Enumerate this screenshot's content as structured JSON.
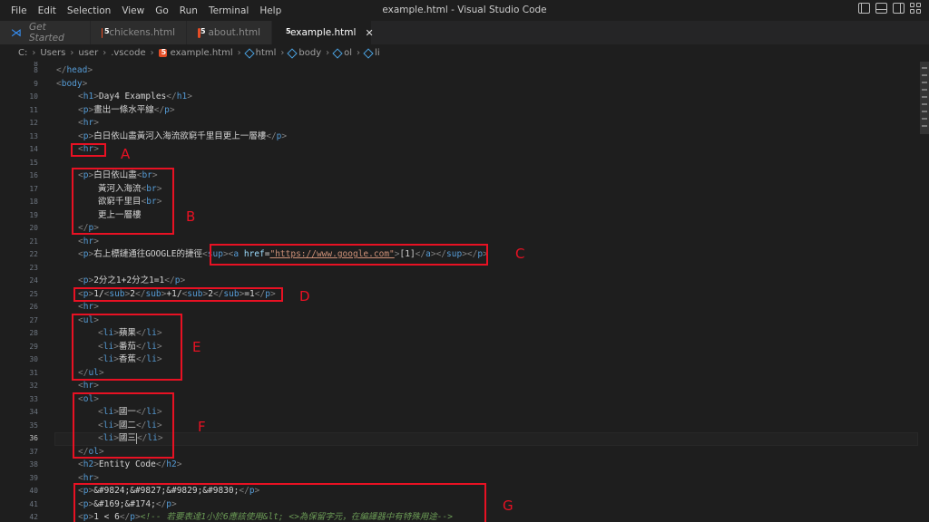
{
  "menu": [
    "File",
    "Edit",
    "Selection",
    "View",
    "Go",
    "Run",
    "Terminal",
    "Help"
  ],
  "window_title": "example.html - Visual Studio Code",
  "tabs": [
    {
      "label": "Get Started",
      "icon": "vscode-icon"
    },
    {
      "label": "chickens.html",
      "icon": "html5-icon"
    },
    {
      "label": "about.html",
      "icon": "html5-icon"
    },
    {
      "label": "example.html",
      "icon": "html5-icon",
      "active": true,
      "close": "✕"
    }
  ],
  "breadcrumb": [
    "C:",
    "Users",
    "user",
    ".vscode",
    "example.html",
    "html",
    "body",
    "ol",
    "li"
  ],
  "lines": [
    {
      "n": "8",
      "cut": true
    },
    {
      "n": "9"
    },
    {
      "n": "10"
    },
    {
      "n": "11"
    },
    {
      "n": "12"
    },
    {
      "n": "13"
    },
    {
      "n": "14"
    },
    {
      "n": "15"
    },
    {
      "n": "16"
    },
    {
      "n": "17"
    },
    {
      "n": "18"
    },
    {
      "n": "19"
    },
    {
      "n": "20"
    },
    {
      "n": "21"
    },
    {
      "n": "22"
    },
    {
      "n": "23"
    },
    {
      "n": "24"
    },
    {
      "n": "25"
    },
    {
      "n": "26"
    },
    {
      "n": "27"
    },
    {
      "n": "28"
    },
    {
      "n": "29"
    },
    {
      "n": "30"
    },
    {
      "n": "31"
    },
    {
      "n": "32"
    },
    {
      "n": "33"
    },
    {
      "n": "34"
    },
    {
      "n": "35"
    },
    {
      "n": "36"
    },
    {
      "n": "37"
    },
    {
      "n": "38"
    },
    {
      "n": "39"
    },
    {
      "n": "40"
    },
    {
      "n": "41"
    },
    {
      "n": "42"
    }
  ],
  "code": {
    "l8": "</head>",
    "l9": "<body>",
    "l10_text": "Day4 Examples",
    "l11_text": "畫出一條水平線",
    "l13_text": "白日依山盡黃河入海流欲窮千里目更上一層樓",
    "l16_text": "白日依山盡",
    "l17_text": "黃河入海流",
    "l18_text": "欲窮千里目",
    "l19_text": "更上一層樓",
    "l22_text": "右上標鏈通往GOOGLE的捷徑",
    "l22_href": "\"https://www.google.com\"",
    "l22_sup": "[1]",
    "l24_text": "2分之1+2分之1=1",
    "l28_text": "蘋果",
    "l29_text": "番茄",
    "l30_text": "香蕉",
    "l34_text": "國一",
    "l35_text": "國二",
    "l36_text": "國三",
    "l38_text": "Entity Code",
    "l40_text": "&#9824;&#9827;&#9829;&#9830;",
    "l41_text": "&#169;&#174;",
    "l42_text": "1 < 6",
    "l42_comment": "<!-- 若要表達1小於6應該使用&lt; <>為保留字元，在編譯器中有特殊用途-->"
  },
  "annotations": [
    "A",
    "B",
    "C",
    "D",
    "E",
    "F",
    "G"
  ],
  "colors": {
    "annotation": "#e81123",
    "tag": "#569cd6",
    "string": "#ce9178",
    "attr": "#9cdcfe",
    "comment": "#6a9955"
  }
}
